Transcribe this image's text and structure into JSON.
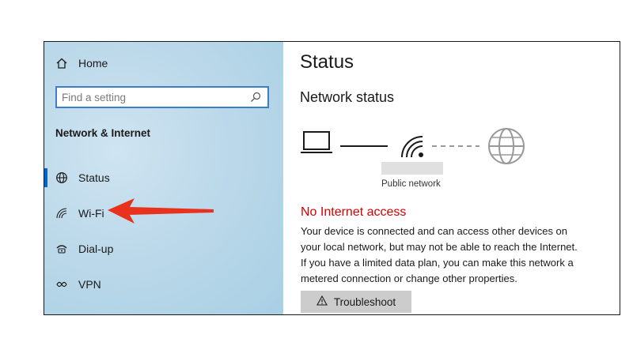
{
  "sidebar": {
    "home_label": "Home",
    "search_placeholder": "Find a setting",
    "section_title": "Network & Internet",
    "items": [
      {
        "label": "Status",
        "icon": "status-globe-icon"
      },
      {
        "label": "Wi-Fi",
        "icon": "wifi-icon"
      },
      {
        "label": "Dial-up",
        "icon": "dialup-icon"
      },
      {
        "label": "VPN",
        "icon": "vpn-icon"
      }
    ],
    "selected": "Status"
  },
  "main": {
    "title": "Status",
    "subtitle": "Network status",
    "network_type": "Public network",
    "status_heading": "No Internet access",
    "description": "Your device is connected and can access other devices on your local network, but may not be able to reach the Internet. If you have a limited data plan, you can make this network a metered connection or change other properties.",
    "troubleshoot_label": "Troubleshoot"
  },
  "colors": {
    "accent": "#0066cc",
    "error": "#d40000",
    "annotation_arrow": "#e8321d",
    "sidebar_bg": "#bcd9ea"
  }
}
